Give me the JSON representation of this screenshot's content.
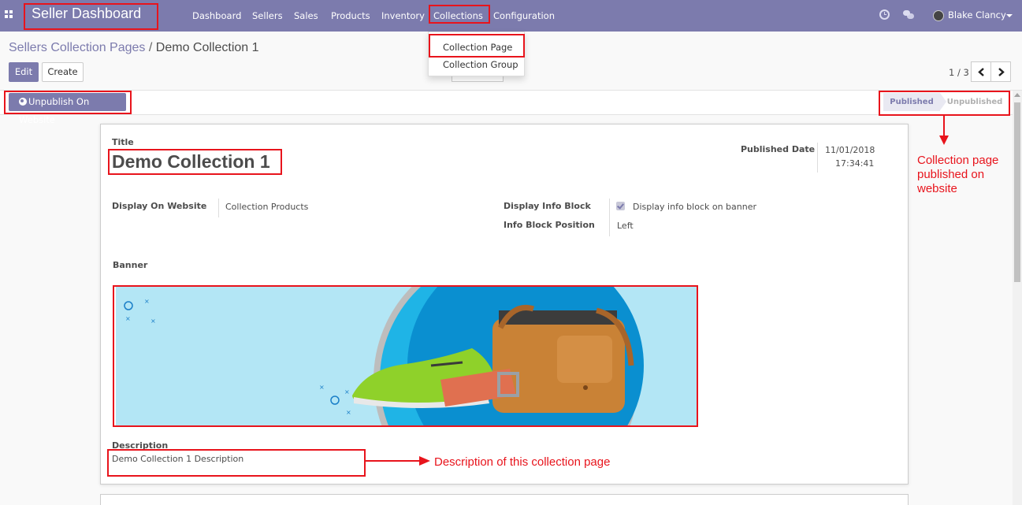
{
  "navbar": {
    "brand": "Seller Dashboard",
    "menu": [
      "Dashboard",
      "Sellers",
      "Sales",
      "Products",
      "Inventory",
      "Collections",
      "Configuration"
    ],
    "user": "Blake Clancy"
  },
  "dropdown": {
    "items": [
      "Collection Page",
      "Collection Group"
    ]
  },
  "breadcrumb": {
    "parent": "Sellers Collection Pages",
    "separator": "/",
    "current": "Demo Collection 1"
  },
  "buttons": {
    "edit": "Edit",
    "create": "Create",
    "unpublish": "Unpublish On Website"
  },
  "pager": {
    "text": "1 / 3"
  },
  "statusbar": {
    "stages": [
      "Published",
      "Unpublished"
    ],
    "active": "Published"
  },
  "form": {
    "title_label": "Title",
    "title_value": "Demo Collection 1",
    "published_date_label": "Published Date",
    "published_date": "11/01/2018",
    "published_time": "17:34:41",
    "display_on_website_label": "Display On Website",
    "display_on_website_value": "Collection Products",
    "display_info_block_label": "Display Info Block",
    "display_info_block_text": "Display info block on banner",
    "display_info_block_checked": true,
    "info_block_position_label": "Info Block Position",
    "info_block_position_value": "Left",
    "banner_label": "Banner",
    "description_label": "Description",
    "description_value": "Demo Collection 1 Description"
  },
  "annotations": {
    "published_note": [
      "Collection page",
      "published on",
      "website"
    ],
    "description_note": "Description of this collection page",
    "color": "#e8141c"
  },
  "colors": {
    "brand": "#7c7bad",
    "annotation": "#e8141c"
  }
}
